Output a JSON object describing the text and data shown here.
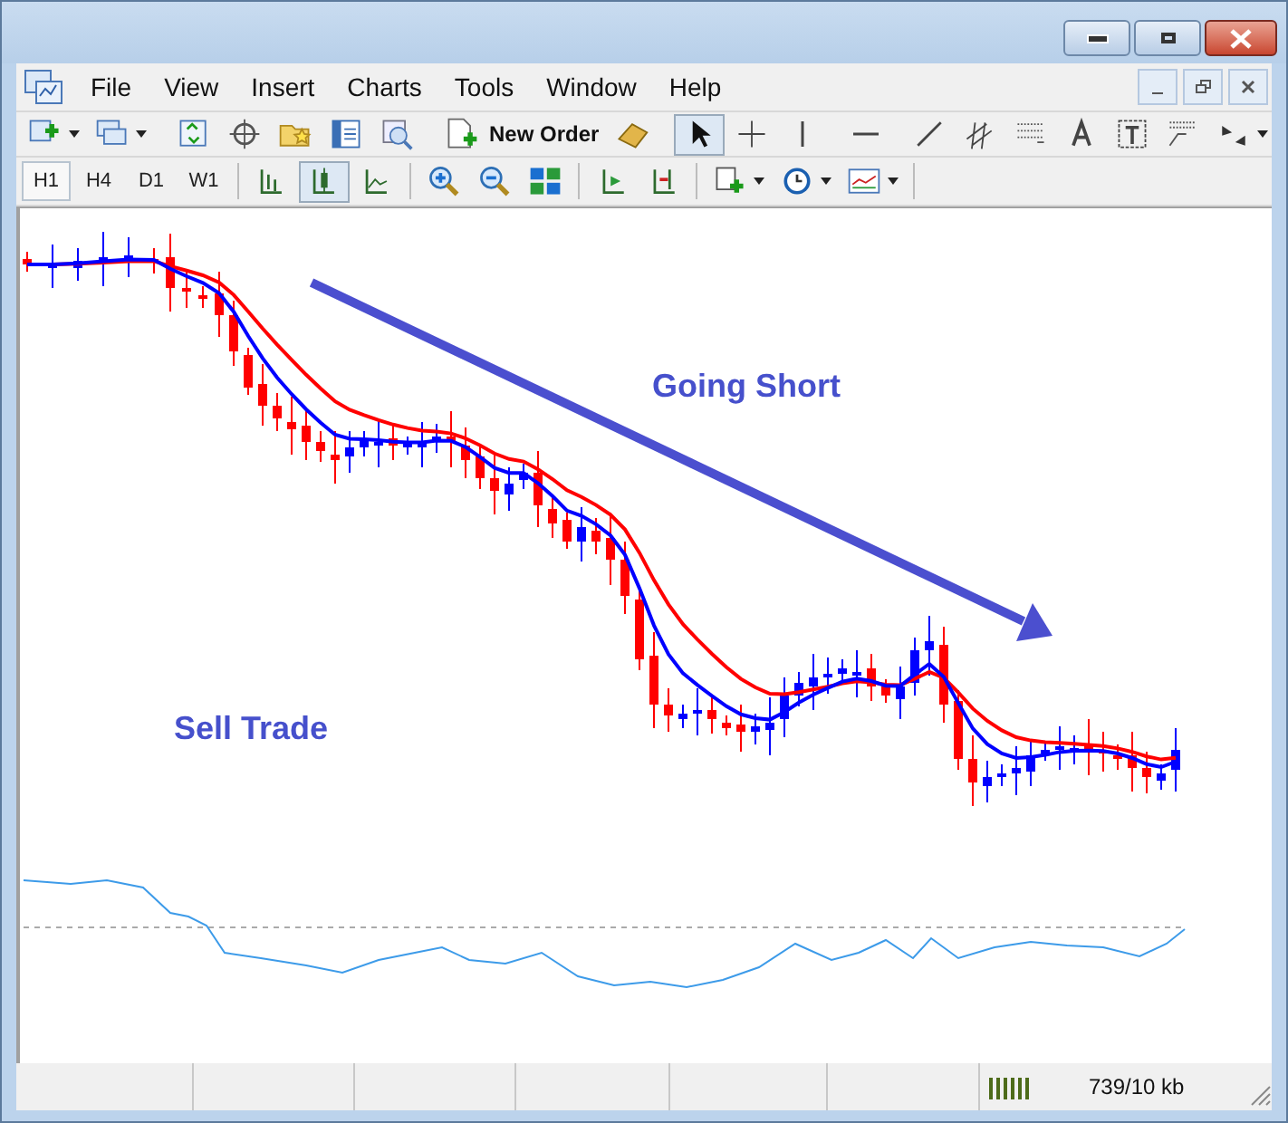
{
  "menu": [
    "File",
    "View",
    "Insert",
    "Charts",
    "Tools",
    "Window",
    "Help"
  ],
  "toolbar": {
    "new_order": "New Order"
  },
  "timeframes": [
    {
      "label": "H1",
      "selected": true
    },
    {
      "label": "H4",
      "selected": false
    },
    {
      "label": "D1",
      "selected": false
    },
    {
      "label": "W1",
      "selected": false
    }
  ],
  "chart": {
    "annotations": [
      {
        "kind": "title",
        "text": "Going Short"
      },
      {
        "kind": "label",
        "text": "Sell Trade"
      }
    ]
  },
  "status_bar": {
    "traffic": "739/10 kb"
  }
}
